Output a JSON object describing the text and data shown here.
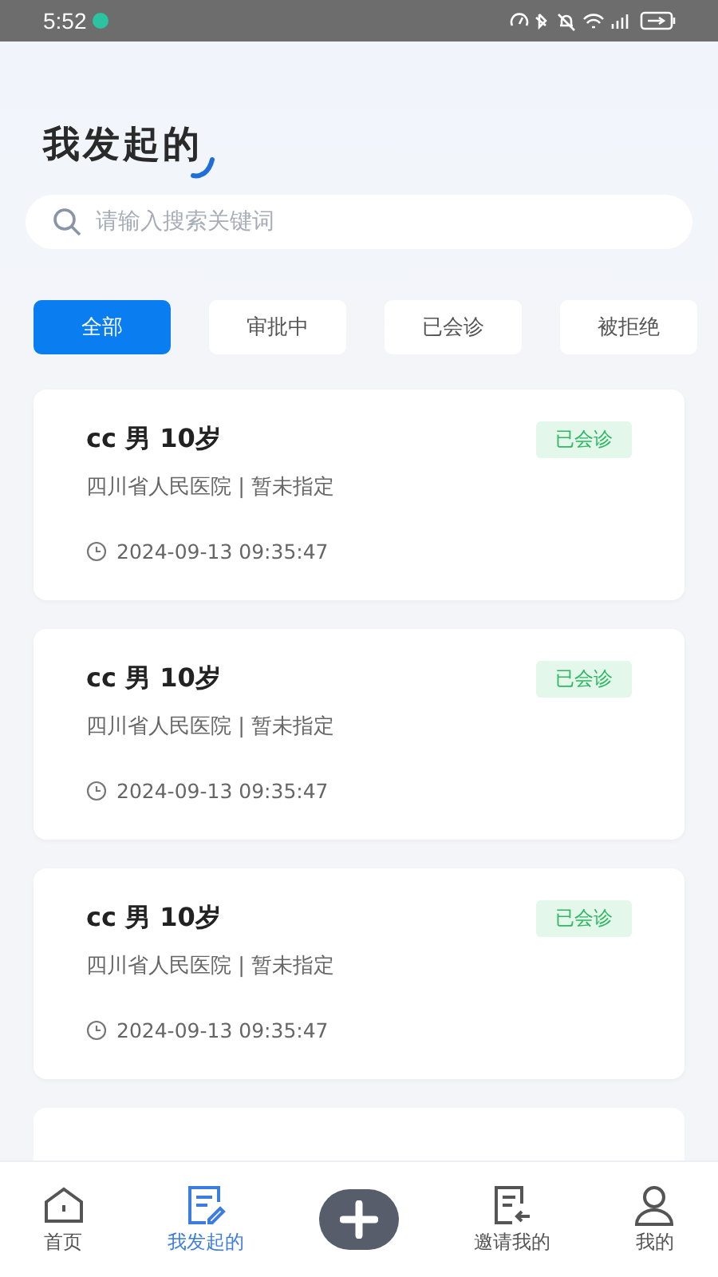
{
  "status_bar": {
    "time": "5:52"
  },
  "header": {
    "title": "我发起的"
  },
  "search": {
    "placeholder": "请输入搜索关键词"
  },
  "filters": [
    {
      "label": "全部",
      "selected": true
    },
    {
      "label": "审批中",
      "selected": false
    },
    {
      "label": "已会诊",
      "selected": false
    },
    {
      "label": "被拒绝",
      "selected": false
    }
  ],
  "cards": [
    {
      "title": "cc 男 10岁",
      "status": "已会诊",
      "hospital": "四川省人民医院 | 暂未指定",
      "time": "2024-09-13 09:35:47"
    },
    {
      "title": "cc 男 10岁",
      "status": "已会诊",
      "hospital": "四川省人民医院 | 暂未指定",
      "time": "2024-09-13 09:35:47"
    },
    {
      "title": "cc 男 10岁",
      "status": "已会诊",
      "hospital": "四川省人民医院 | 暂未指定",
      "time": "2024-09-13 09:35:47"
    }
  ],
  "tab_bar": [
    {
      "kind": "home",
      "label": "首页",
      "selected": false
    },
    {
      "kind": "edit",
      "label": "我发起的",
      "selected": true
    },
    {
      "kind": "add"
    },
    {
      "kind": "invite",
      "label": "邀请我的",
      "selected": false
    },
    {
      "kind": "user",
      "label": "我的",
      "selected": false
    }
  ]
}
